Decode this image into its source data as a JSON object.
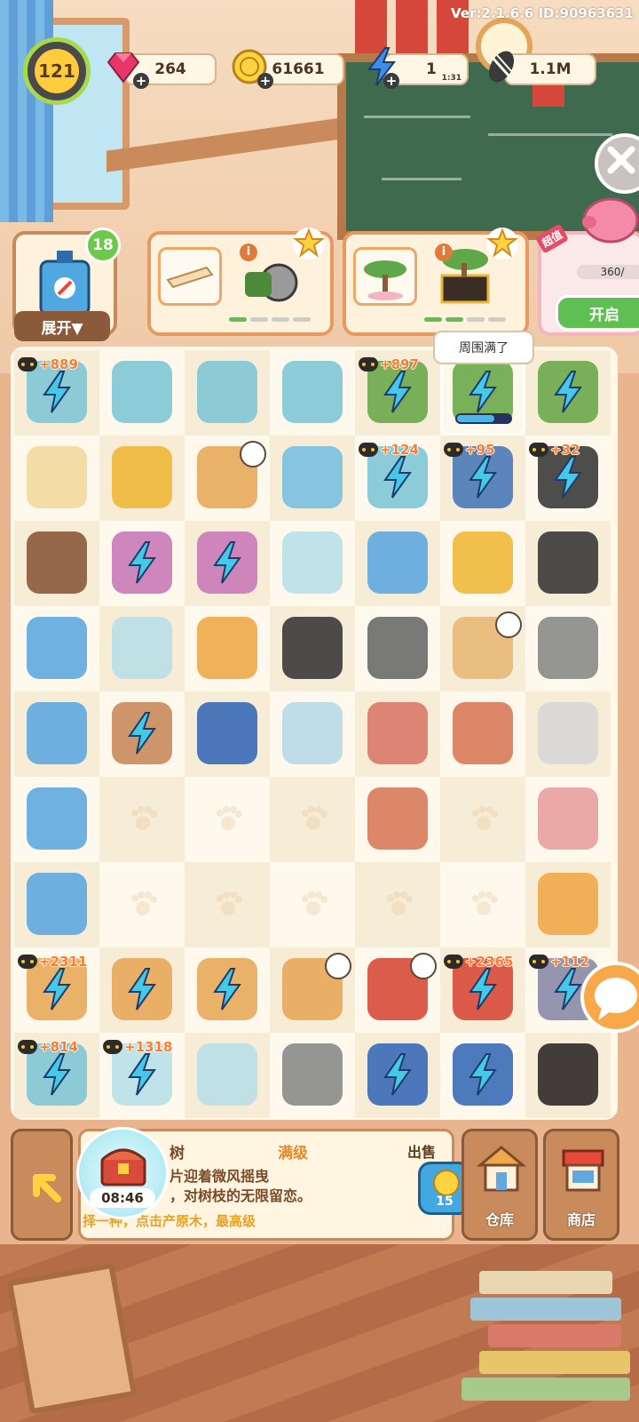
{
  "header": {
    "version": "Ver:2.1.6.6 ID:90963631",
    "level": "121",
    "gems": "264",
    "coins": "61661",
    "energy": "1",
    "energy_timer": "1:31",
    "seeds": "1.1M"
  },
  "orders": {
    "inventory_count": "18",
    "expand_label": "展开▼",
    "promo_tag": "超值",
    "piggy_progress": "360/",
    "open_label": "开启"
  },
  "board": {
    "tooltip": "周围满了",
    "bonuses": {
      "r0c0": "+889",
      "r0c4": "+897",
      "r1c4": "+124",
      "r1c5": "+95",
      "r1c6": "+32",
      "r7c0": "+2311",
      "r7c5": "+2365",
      "r7c6": "+112",
      "r8c0": "+814",
      "r8c1": "+1318"
    },
    "selected_energy_fraction": 0.7
  },
  "bottom": {
    "item_name": "树",
    "item_level": "满级",
    "desc_line1": "片迎着微风摇曳",
    "desc_line2": "，对树枝的无限留恋。",
    "hint": "择一种，点击产原木，最高级",
    "sell_label": "出售",
    "sell_price": "15",
    "chest_timer": "08:46",
    "warehouse_label": "仓库",
    "shop_label": "商店"
  },
  "colors": {
    "bonus_text": "#ff7a2a",
    "bolt": "#45c9e8",
    "progress_green": "#5fbf52"
  }
}
